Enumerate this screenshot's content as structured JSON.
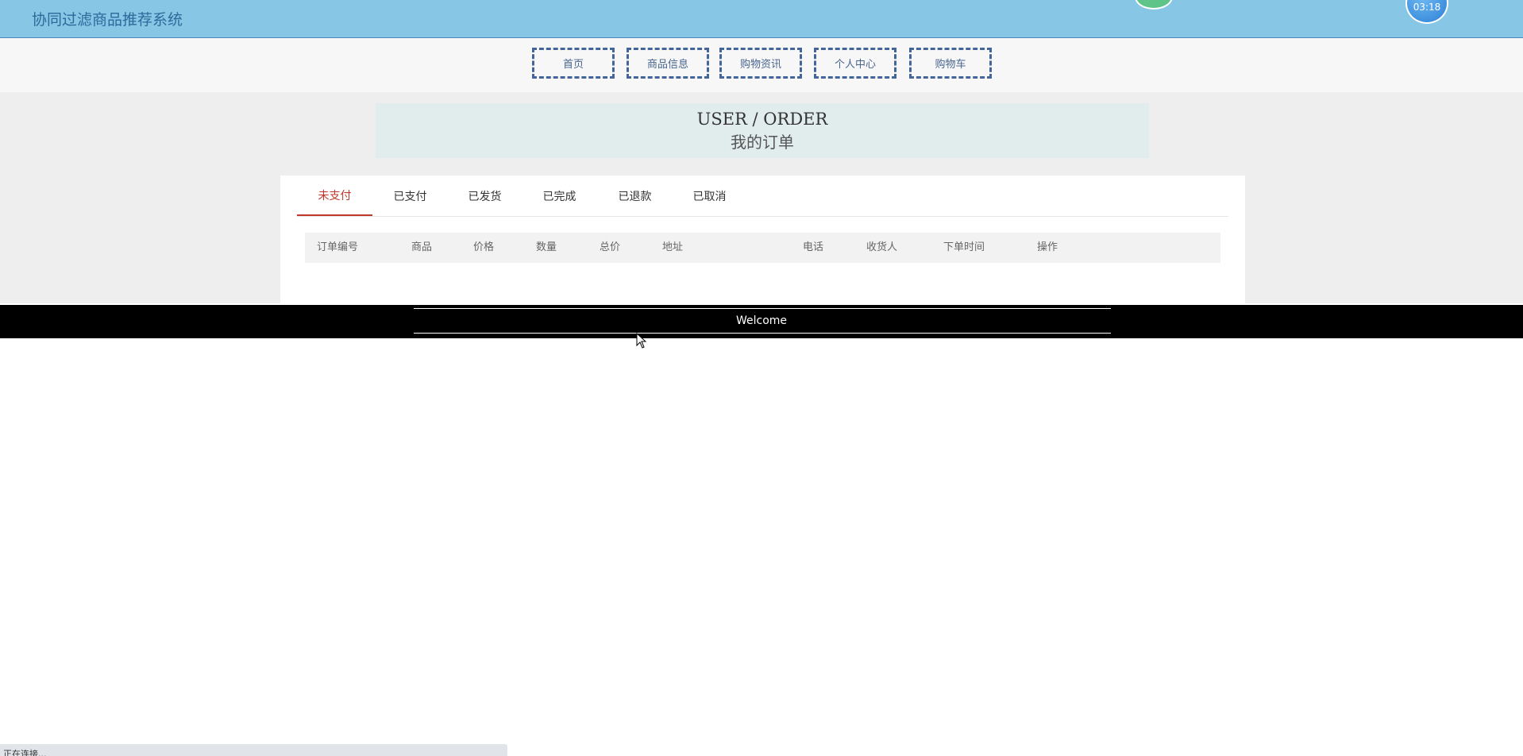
{
  "header": {
    "title": "协同过滤商品推荐系统",
    "clock_time": "03:18"
  },
  "nav": {
    "items": [
      {
        "label": "首页",
        "name": "nav-home"
      },
      {
        "label": "商品信息",
        "name": "nav-products"
      },
      {
        "label": "购物资讯",
        "name": "nav-news"
      },
      {
        "label": "个人中心",
        "name": "nav-profile"
      },
      {
        "label": "购物车",
        "name": "nav-cart"
      }
    ]
  },
  "page_title": {
    "en": "USER / ORDER",
    "zh": "我的订单"
  },
  "tabs": {
    "active_index": 0,
    "items": [
      "未支付",
      "已支付",
      "已发货",
      "已完成",
      "已退款",
      "已取消"
    ]
  },
  "table": {
    "columns": [
      "订单编号",
      "商品",
      "价格",
      "数量",
      "总价",
      "地址",
      "电话",
      "收货人",
      "下单时间",
      "操作"
    ],
    "rows": []
  },
  "footer": {
    "text": "Welcome"
  },
  "status_bar": {
    "text": "正在连接..."
  },
  "colors": {
    "header_bg": "#88c6e6",
    "nav_border": "#44659a",
    "active_tab": "#c0392b",
    "footer_bg": "#000000"
  }
}
